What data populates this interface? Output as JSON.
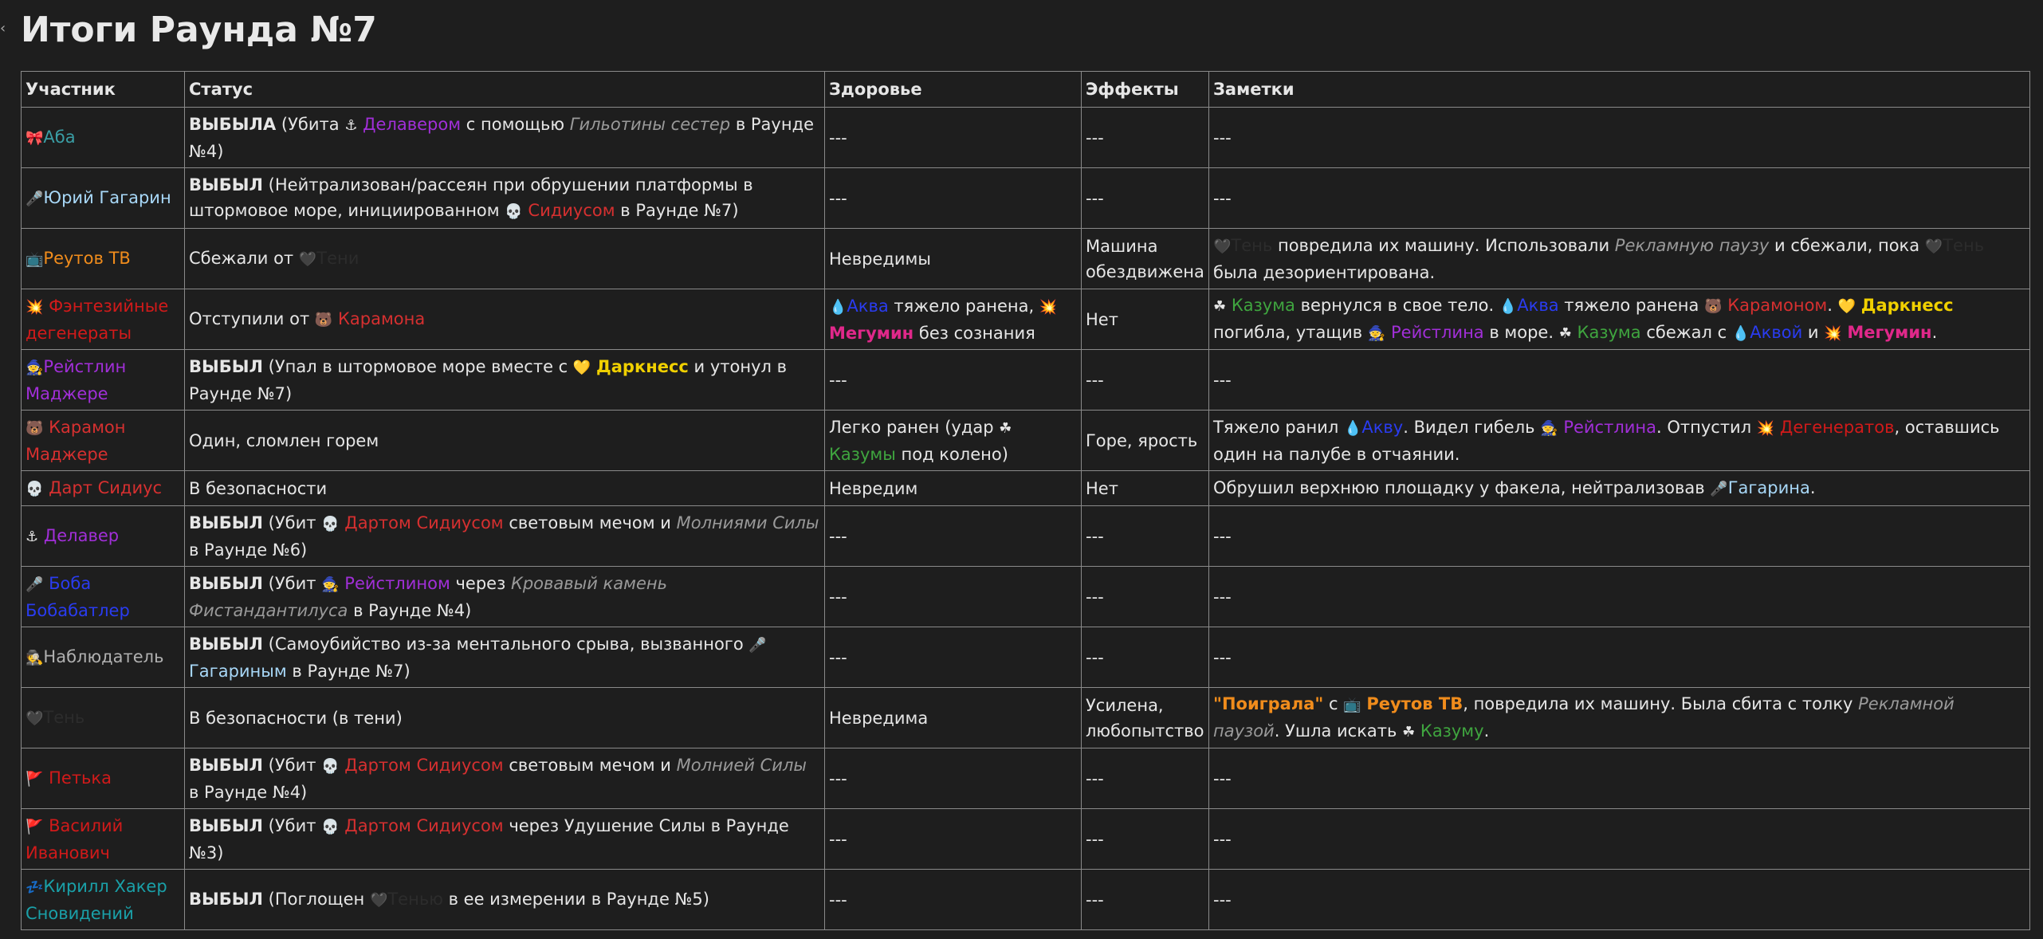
{
  "page": {
    "title": "Итоги Раунда №7",
    "edge_marker": "‹"
  },
  "colors": {
    "background": "#1e1e1e",
    "text": "#e6e6e6",
    "border": "#8a8a8a"
  },
  "table": {
    "headers": [
      "Участник",
      "Статус",
      "Здоровье",
      "Эффекты",
      "Заметки"
    ],
    "empty": "---",
    "rows": [
      {
        "participant": {
          "emoji": "🎀",
          "name": "Аба"
        },
        "status": {
          "bold": "ВЫБЫЛА",
          "t1": "(Убита",
          "killer_emoji": "⚓",
          "killer": "Делавером",
          "t2": "с помощью",
          "weapon": "Гильотины сестер",
          "t3": "в Раунде №4)"
        },
        "health": "---",
        "effects": "---",
        "notes": "---"
      },
      {
        "participant": {
          "emoji": "🎤",
          "name": "Юрий Гагарин"
        },
        "status": {
          "bold": "ВЫБЫЛ",
          "t1": "(Нейтрализован/рассеян при обрушении платформы в штормовое море, инициированном",
          "killer_emoji": "💀",
          "killer": "Сидиусом",
          "t3": "в Раунде №7)"
        },
        "health": "---",
        "effects": "---",
        "notes": "---"
      },
      {
        "participant": {
          "emoji": "📺",
          "name": "Реутов ТВ"
        },
        "status": {
          "t1": "Сбежали от",
          "ref_emoji": "🖤",
          "ref": "Тени"
        },
        "health": "Невредимы",
        "effects": "Машина обездвижена",
        "notes": {
          "e1": "🖤",
          "n1": "Тень",
          "t1": "повредила их машину. Использовали",
          "i1": "Рекламную паузу",
          "t2": "и сбежали, пока",
          "e2": "🖤",
          "n2": "Тень",
          "t3": "была дезориентирована."
        }
      },
      {
        "participant": {
          "emoji": "💥",
          "name": "Фэнтезийные дегенераты"
        },
        "status": {
          "t1": "Отступили от",
          "ref_emoji": "🐻",
          "ref": "Карамона"
        },
        "health": {
          "e1": "💧",
          "n1": "Аква",
          "t1": "тяжело ранена,",
          "e2": "💥",
          "n2": "Мегумин",
          "t2": "без сознания"
        },
        "effects": "Нет",
        "notes": {
          "e1": "☘",
          "n1": "Казума",
          "t1": "вернулся в свое тело.",
          "e2": "💧",
          "n2": "Аква",
          "t2": "тяжело ранена",
          "e3": "🐻",
          "n3": "Карамоном",
          "t3": ".",
          "e4": "💛",
          "n4": "Даркнесс",
          "t4": "погибла, утащив",
          "e5": "🧙",
          "n5": "Рейстлина",
          "t5": "в море.",
          "e6": "☘",
          "n6": "Казума",
          "t6": "сбежал с",
          "e7": "💧",
          "n7": "Аквой",
          "t7": "и",
          "e8": "💥",
          "n8": "Мегумин",
          "t8": "."
        }
      },
      {
        "participant": {
          "emoji": "🧙",
          "name": "Рейстлин Маджере"
        },
        "status": {
          "bold": "ВЫБЫЛ",
          "t1": "(Упал в штормовое море вместе с",
          "ref_emoji": "💛",
          "ref": "Даркнесс",
          "t3": "и утонул в Раунде №7)"
        },
        "health": "---",
        "effects": "---",
        "notes": "---"
      },
      {
        "participant": {
          "emoji": "🐻",
          "name": "Карамон Маджере"
        },
        "status": {
          "t1": "Один, сломлен горем"
        },
        "health": {
          "t1": "Легко ранен (удар",
          "e1": "☘",
          "n1": "Казумы",
          "t2": "под колено)"
        },
        "effects": "Горе, ярость",
        "notes": {
          "t1": "Тяжело ранил",
          "e1": "💧",
          "n1": "Акву",
          "t2": ". Видел гибель",
          "e2": "🧙",
          "n2": "Рейстлина",
          "t3": ". Отпустил",
          "e3": "💥",
          "n3": "Дегенератов",
          "t4": ", оставшись один на палубе в отчаянии."
        }
      },
      {
        "participant": {
          "emoji": "💀",
          "name": "Дарт Сидиус"
        },
        "status": {
          "t1": "В безопасности"
        },
        "health": "Невредим",
        "effects": "Нет",
        "notes": {
          "t1": "Обрушил верхнюю площадку у факела, нейтрализовав",
          "e1": "🎤",
          "n1": "Гагарина",
          "t2": "."
        }
      },
      {
        "participant": {
          "emoji": "⚓",
          "name": "Делавер"
        },
        "status": {
          "bold": "ВЫБЫЛ",
          "t1": "(Убит",
          "killer_emoji": "💀",
          "killer": "Дартом Сидиусом",
          "t2": "световым мечом и",
          "weapon": "Молниями Силы",
          "t3": "в Раунде №6)"
        },
        "health": "---",
        "effects": "---",
        "notes": "---"
      },
      {
        "participant": {
          "emoji": "🎤",
          "name": "Боба Бобабатлер"
        },
        "status": {
          "bold": "ВЫБЫЛ",
          "t1": "(Убит",
          "killer_emoji": "🧙",
          "killer": "Рейстлином",
          "t2": "через",
          "weapon": "Кровавый камень Фистандантилуса",
          "t3": "в Раунде №4)"
        },
        "health": "---",
        "effects": "---",
        "notes": "---"
      },
      {
        "participant": {
          "emoji": "🕵",
          "name": "Наблюдатель"
        },
        "status": {
          "bold": "ВЫБЫЛ",
          "t1": "(Самоубийство из-за ментального срыва, вызванного",
          "killer_emoji": "🎤",
          "killer": "Гагариным",
          "t3": "в Раунде №7)"
        },
        "health": "---",
        "effects": "---",
        "notes": "---"
      },
      {
        "participant": {
          "emoji": "🖤",
          "name": "Тень"
        },
        "status": {
          "t1": "В безопасности (в тени)"
        },
        "health": "Невредима",
        "effects": "Усилена, любопытство",
        "notes": {
          "q1": "\"Поиграла\"",
          "t1": "с",
          "e1": "📺",
          "n1": "Реутов ТВ",
          "t2": ", повредила их машину. Была сбита с толку",
          "i1": "Рекламной паузой",
          "t3": ". Ушла искать",
          "e2": "☘",
          "n2": "Казуму",
          "t4": "."
        }
      },
      {
        "participant": {
          "emoji": "🚩",
          "name": "Петька"
        },
        "status": {
          "bold": "ВЫБЫЛ",
          "t1": "(Убит",
          "killer_emoji": "💀",
          "killer": "Дартом Сидиусом",
          "t2": "световым мечом и",
          "weapon": "Молнией Силы",
          "t3": "в Раунде №4)"
        },
        "health": "---",
        "effects": "---",
        "notes": "---"
      },
      {
        "participant": {
          "emoji": "🚩",
          "name": "Василий Иванович"
        },
        "status": {
          "bold": "ВЫБЫЛ",
          "t1": "(Убит",
          "killer_emoji": "💀",
          "killer": "Дартом Сидиусом",
          "t3": "через Удушение Силы в Раунде №3)"
        },
        "health": "---",
        "effects": "---",
        "notes": "---"
      },
      {
        "participant": {
          "emoji": "💤",
          "name": "Кирилл Хакер Сновидений"
        },
        "status": {
          "bold": "ВЫБЫЛ",
          "t1": "(Поглощен",
          "killer_emoji": "🖤",
          "killer": "Тенью",
          "t3": "в ее измерении в Раунде №5)"
        },
        "health": "---",
        "effects": "---",
        "notes": "---"
      }
    ]
  }
}
